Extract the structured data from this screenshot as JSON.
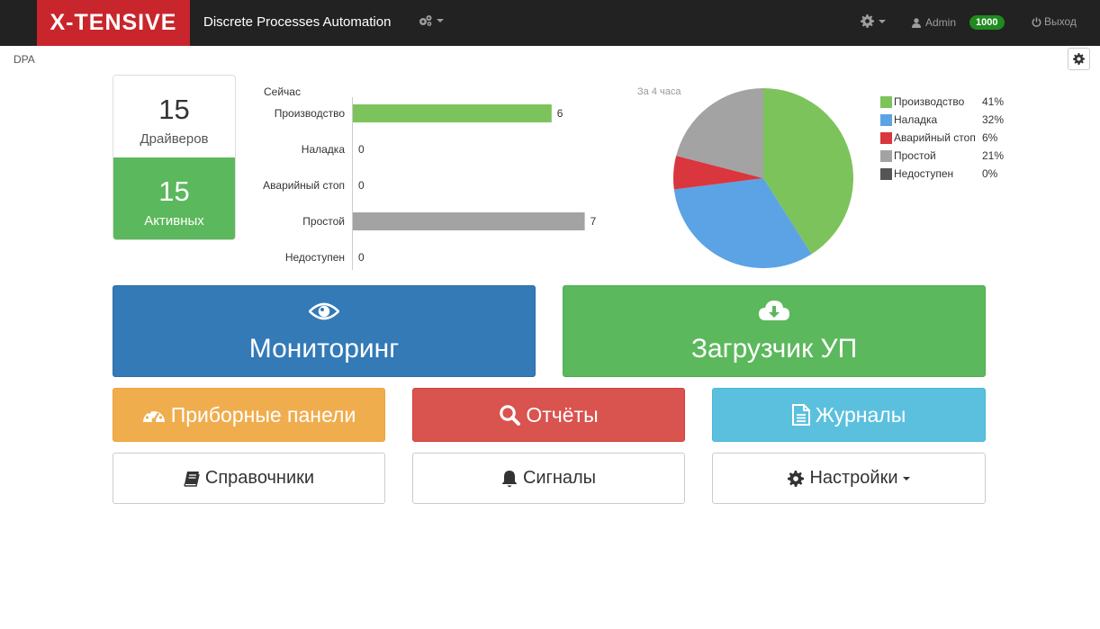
{
  "navbar": {
    "brand": "X-TENSIVE",
    "title": "Discrete Processes Automation",
    "user": "Admin",
    "badge": "1000",
    "logout": "Выход",
    "icons": [
      "cogs-icon",
      "gear-icon",
      "user-icon",
      "power-icon"
    ]
  },
  "breadcrumb": "DPA",
  "counters": {
    "drivers_value": "15",
    "drivers_label": "Драйверов",
    "active_value": "15",
    "active_label": "Активных"
  },
  "now_chart": {
    "title": "Сейчас"
  },
  "pie_title": "За 4 часа",
  "colors": {
    "production": "#7dc35b",
    "setup": "#5ba3e4",
    "emergency": "#d9363e",
    "idle": "#a3a3a3",
    "unavailable": "#555555"
  },
  "chart_data": [
    {
      "type": "bar",
      "title": "Сейчас",
      "categories": [
        "Производство",
        "Наладка",
        "Аварийный стоп",
        "Простой",
        "Недоступен"
      ],
      "values": [
        6,
        0,
        0,
        7,
        0
      ],
      "colors": [
        "#7dc35b",
        "#5ba3e4",
        "#d9363e",
        "#a3a3a3",
        "#555555"
      ],
      "orientation": "horizontal"
    },
    {
      "type": "pie",
      "title": "За 4 часа",
      "categories": [
        "Производство",
        "Наладка",
        "Аварийный стоп",
        "Простой",
        "Недоступен"
      ],
      "values": [
        41,
        32,
        6,
        21,
        0
      ],
      "labels": [
        "41%",
        "32%",
        "6%",
        "21%",
        "0%"
      ],
      "colors": [
        "#7dc35b",
        "#5ba3e4",
        "#d9363e",
        "#a3a3a3",
        "#555555"
      ],
      "legend": "right"
    }
  ],
  "tiles": {
    "monitoring": "Мониторинг",
    "loader": "Загрузчик УП",
    "panels": "Приборные панели",
    "reports": "Отчёты",
    "logs": "Журналы",
    "references": "Справочники",
    "signals": "Сигналы",
    "settings": "Настройки"
  }
}
